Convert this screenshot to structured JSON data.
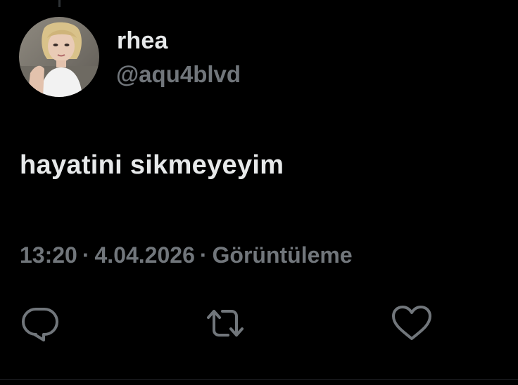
{
  "tweet": {
    "author": {
      "display_name": "rhea",
      "handle": "@aqu4blvd"
    },
    "text": "hayatini sikmeyeyim",
    "meta": {
      "time": "13:20",
      "date": "4.04.2026",
      "separator": "·",
      "views_label": "Görüntüleme"
    },
    "actions": [
      {
        "name": "reply",
        "icon": "reply-icon"
      },
      {
        "name": "retweet",
        "icon": "retweet-icon"
      },
      {
        "name": "like",
        "icon": "heart-icon"
      }
    ]
  },
  "colors": {
    "background": "#000000",
    "primary_text": "#e7e9ea",
    "secondary_text": "#71767b",
    "icon": "#71767b"
  }
}
